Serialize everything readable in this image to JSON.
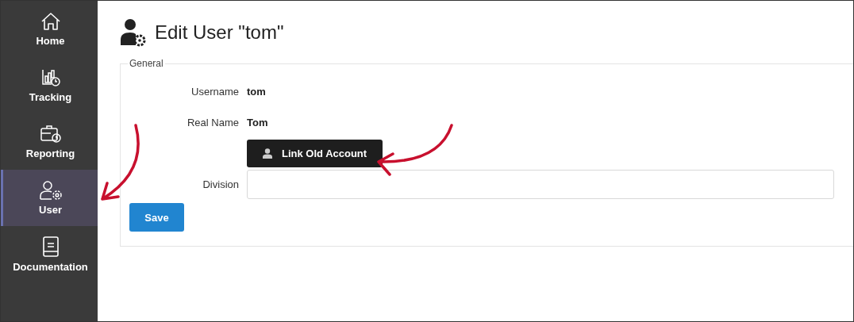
{
  "sidebar": {
    "items": [
      {
        "label": "Home",
        "kind": "home",
        "selected": false
      },
      {
        "label": "Tracking",
        "kind": "tracking",
        "selected": false
      },
      {
        "label": "Reporting",
        "kind": "reporting",
        "selected": false
      },
      {
        "label": "User",
        "kind": "user",
        "selected": true
      },
      {
        "label": "Documentation",
        "kind": "documentation",
        "selected": false
      }
    ]
  },
  "page": {
    "title": "Edit User \"tom\""
  },
  "section": {
    "legend": "General",
    "fields": [
      {
        "kind": "text",
        "label": "Username",
        "value": "tom"
      },
      {
        "kind": "text",
        "label": "Real Name",
        "value": "Tom"
      },
      {
        "kind": "button",
        "label": "Link Old Account"
      },
      {
        "kind": "input",
        "label": "Division"
      }
    ],
    "save": "Save"
  }
}
